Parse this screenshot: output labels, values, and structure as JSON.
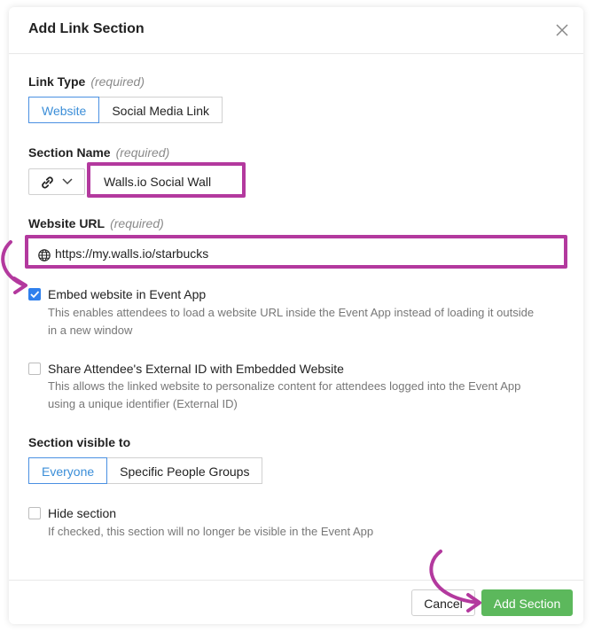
{
  "dialog": {
    "title": "Add Link Section"
  },
  "link_type": {
    "label": "Link Type",
    "required": "(required)",
    "options": [
      "Website",
      "Social Media Link"
    ],
    "selected": "Website"
  },
  "section_name": {
    "label": "Section Name",
    "required": "(required)",
    "icon": "link-icon",
    "value": "Walls.io Social Wall"
  },
  "website_url": {
    "label": "Website URL",
    "required": "(required)",
    "icon": "globe-icon",
    "value": "https://my.walls.io/starbucks"
  },
  "embed": {
    "checked": true,
    "label": "Embed website in Event App",
    "help_line1": "This enables attendees to load a website URL inside the Event App instead of loading it outside",
    "help_line2": "in a new window"
  },
  "share_id": {
    "checked": false,
    "label": "Share Attendee's External ID with Embedded Website",
    "help_line1": "This allows the linked website to personalize content for attendees logged into the Event App",
    "help_line2": "using a unique identifier (External ID)"
  },
  "visibility": {
    "label": "Section visible to",
    "options": [
      "Everyone",
      "Specific People Groups"
    ],
    "selected": "Everyone"
  },
  "hide": {
    "checked": false,
    "label": "Hide section",
    "help": "If checked, this section will no longer be visible in the Event App"
  },
  "footer": {
    "cancel_label": "Cancel",
    "submit_label": "Add Section"
  },
  "colors": {
    "highlight": "#b3399e",
    "accent": "#2f80ed",
    "primary_button": "#5cb85c"
  }
}
